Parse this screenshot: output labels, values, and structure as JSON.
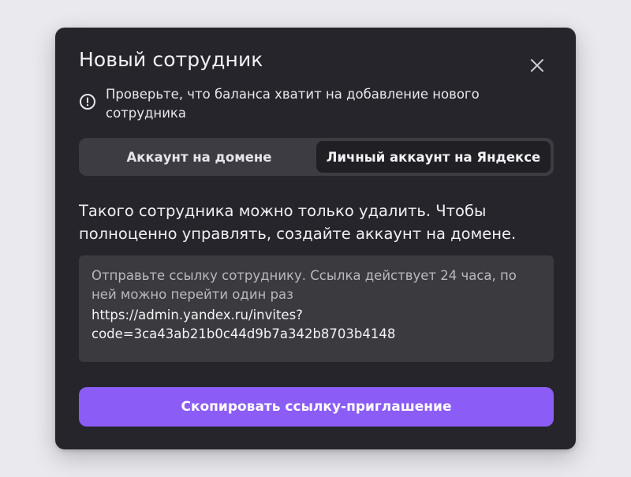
{
  "dialog": {
    "title": "Новый сотрудник",
    "close_icon": "close-icon",
    "warning": {
      "icon": "exclamation-circle-icon",
      "text": "Проверьте, что баланса хватит на добавление нового сотрудника"
    },
    "tabs": [
      {
        "label": "Аккаунт на домене",
        "active": false
      },
      {
        "label": "Личный аккаунт на Яндексе",
        "active": true
      }
    ],
    "description": "Такого сотрудника можно только удалить. Чтобы полноценно управлять, создайте аккаунт на домене.",
    "link_box": {
      "hint": "Отправьте ссылку сотруднику. Ссылка действует 24 часа, по ней можно перейти один раз",
      "url": "https://admin.yandex.ru/invites?\ncode=3ca43ab21b0c44d9b7a342b8703b4148"
    },
    "copy_button_label": "Скопировать ссылку-приглашение",
    "colors": {
      "accent": "#8b5cf6",
      "dialog_bg": "#25252b",
      "page_bg": "#e9e9ee"
    }
  }
}
